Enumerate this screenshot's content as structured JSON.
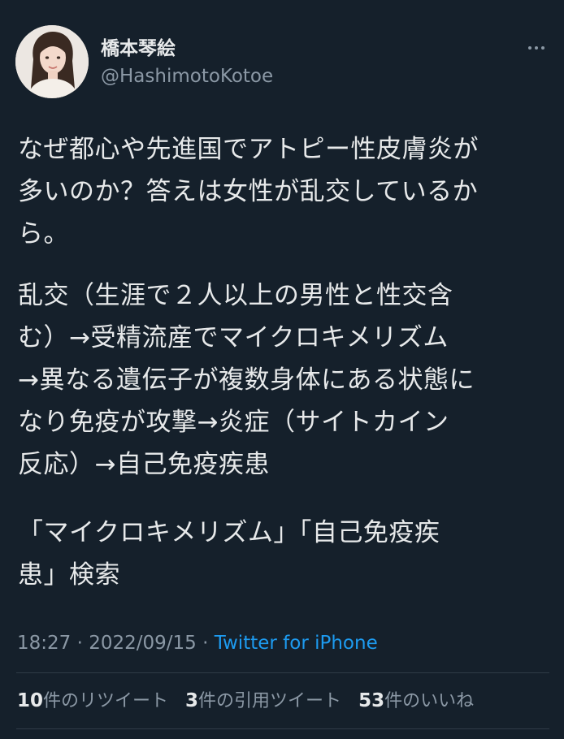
{
  "user": {
    "display_name": "橋本琴絵",
    "handle": "@HashimotoKotoe"
  },
  "tweet": {
    "paragraphs": [
      "なぜ都心や先進国でアトピー性皮膚炎が\n多いのか？答えは女性が乱交しているか\nら。",
      "乱交（生涯で２人以上の男性と性交含\nむ）→受精流産でマイクロキメリズム\n→異なる遺伝子が複数身体にある状態に\nなり免疫が攻撃→炎症（サイトカイン\n反応）→自己免疫疾患",
      "「マイクロキメリズム」「自己免疫疾\n患」検索"
    ]
  },
  "meta": {
    "time": "18:27",
    "separator": " · ",
    "date": "2022/09/15",
    "source": "Twitter for iPhone"
  },
  "stats": {
    "retweets_count": "10",
    "retweets_label": "件のリツイート",
    "quotes_count": "3",
    "quotes_label": "件の引用ツイート",
    "likes_count": "53",
    "likes_label": "件のいいね"
  },
  "icons": {
    "more": "more-horizontal-icon"
  }
}
